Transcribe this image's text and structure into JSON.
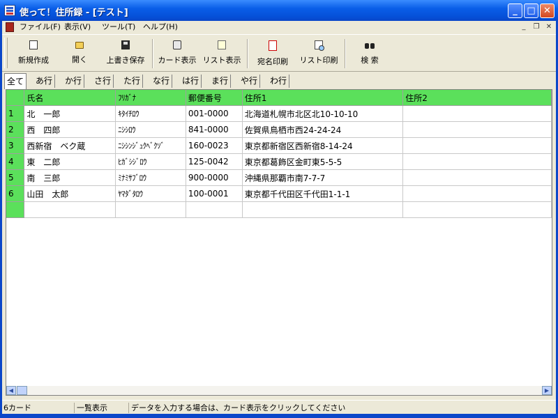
{
  "window": {
    "title": "使って！住所録 - [テスト]"
  },
  "menu": {
    "items": [
      "ファイル(F)",
      "表示(V)",
      "ツール(T)",
      "ヘルプ(H)"
    ]
  },
  "toolbar": {
    "new": "新規作成",
    "open": "開く",
    "save": "上書き保存",
    "card_view": "カード表示",
    "list_view": "リスト表示",
    "label_print": "宛名印刷",
    "list_print": "リスト印刷",
    "search": "検 索"
  },
  "tabs": [
    "全て",
    "あ行",
    "か行",
    "さ行",
    "た行",
    "な行",
    "は行",
    "ま行",
    "や行",
    "わ行"
  ],
  "grid": {
    "columns": [
      "氏名",
      "ﾌﾘｶﾞﾅ",
      "郵便番号",
      "住所1",
      "住所2"
    ],
    "rows": [
      {
        "num": "1",
        "name": "北　一郎",
        "kana": "ｷﾀｲﾁﾛｳ",
        "zip": "001-0000",
        "addr1": "北海道札幌市北区北10-10-10",
        "addr2": ""
      },
      {
        "num": "2",
        "name": "西　四郎",
        "kana": "ﾆｼｼﾛｳ",
        "zip": "841-0000",
        "addr1": "佐賀県鳥栖市西24-24-24",
        "addr2": ""
      },
      {
        "num": "3",
        "name": "西新宿　ベク蔵",
        "kana": "ﾆｼｼﾝｼﾞｭｸﾍﾞｸｿﾞ",
        "zip": "160-0023",
        "addr1": "東京都新宿区西新宿8-14-24",
        "addr2": ""
      },
      {
        "num": "4",
        "name": "東　二郎",
        "kana": "ﾋｶﾞｼｼﾞﾛｳ",
        "zip": "125-0042",
        "addr1": "東京都葛飾区金町東5-5-5",
        "addr2": ""
      },
      {
        "num": "5",
        "name": "南　三郎",
        "kana": "ﾐﾅﾐｻﾌﾞﾛｳ",
        "zip": "900-0000",
        "addr1": "沖縄県那覇市南7-7-7",
        "addr2": ""
      },
      {
        "num": "6",
        "name": "山田　太郎",
        "kana": "ﾔﾏﾀﾞﾀﾛｳ",
        "zip": "100-0001",
        "addr1": "東京都千代田区千代田1-1-1",
        "addr2": ""
      }
    ]
  },
  "status": {
    "count": "6カード",
    "mode": "一覧表示",
    "hint": "データを入力する場合は、カード表示をクリックしてください"
  },
  "icons": [
    "app-icon",
    "new-doc-icon",
    "open-folder-icon",
    "save-disk-icon",
    "card-icon",
    "list-icon",
    "label-print-icon",
    "list-print-icon",
    "binoculars-icon"
  ]
}
